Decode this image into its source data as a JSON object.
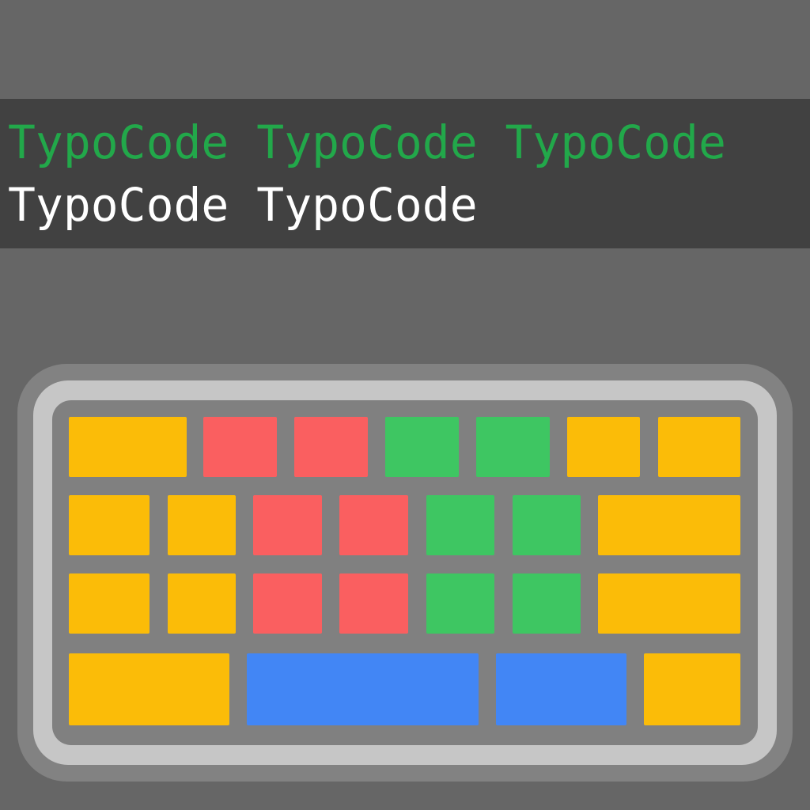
{
  "banner": {
    "typed_text": "TypoCode TypoCode TypoCode",
    "pending_text": "TypoCode TypoCode"
  },
  "colors": {
    "background": "#666666",
    "banner": "#414141",
    "typed_text": "#22a84a",
    "pending_text": "#ffffff",
    "key_yellow": "#fbbc08",
    "key_red": "#fa5f60",
    "key_green": "#3ec662",
    "key_blue": "#4286f5"
  },
  "keyboard": {
    "rows": [
      [
        "yellow",
        "red",
        "red",
        "green",
        "green",
        "yellow",
        "yellow"
      ],
      [
        "yellow",
        "yellow",
        "red",
        "red",
        "green",
        "green",
        "yellow"
      ],
      [
        "yellow",
        "yellow",
        "red",
        "red",
        "green",
        "green",
        "yellow"
      ],
      [
        "yellow",
        "blue",
        "blue",
        "yellow"
      ]
    ]
  }
}
